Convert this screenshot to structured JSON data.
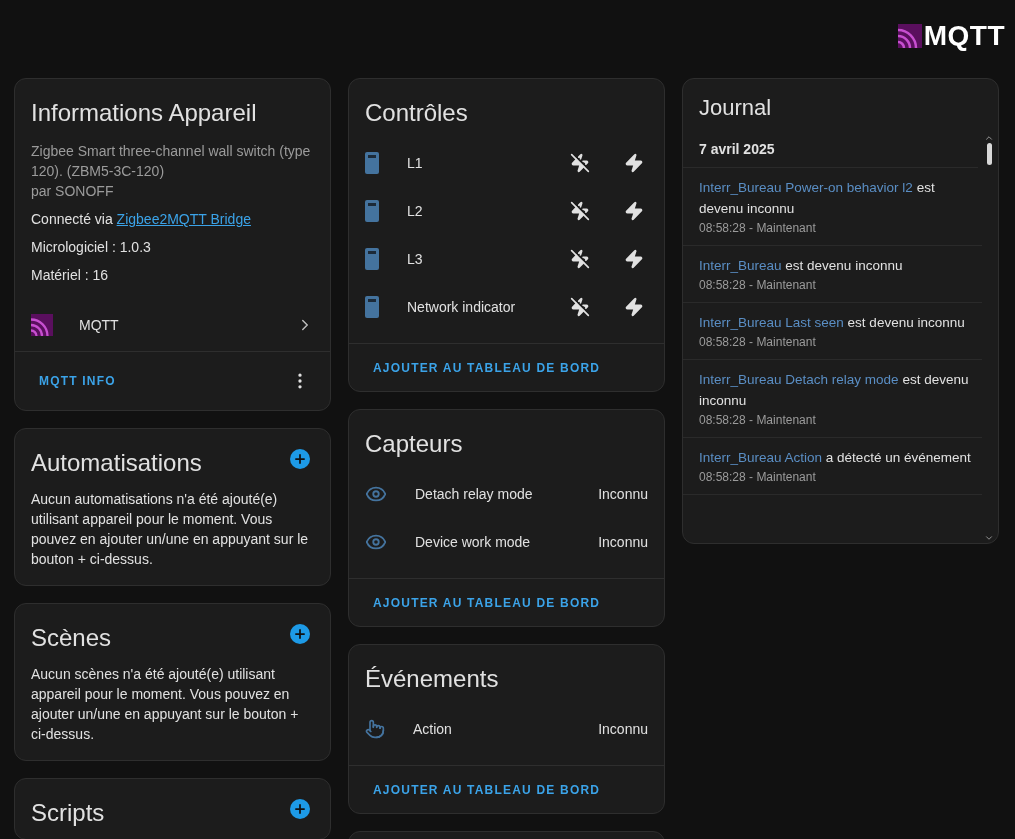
{
  "header": {
    "logo": "MQTT"
  },
  "device": {
    "title": "Informations Appareil",
    "description": "Zigbee Smart three-channel wall switch (type 120). (ZBM5-3C-120)",
    "manufacturer": "par SONOFF",
    "connected_label": "Connecté via",
    "connected_link": "Zigbee2MQTT Bridge",
    "firmware": "Micrologiciel : 1.0.3",
    "hardware": "Matériel : 16",
    "integration": "MQTT",
    "action": "MQTT INFO"
  },
  "sections": [
    {
      "title": "Automatisations",
      "text": "Aucun automatisations n'a été ajouté(e) utilisant appareil pour le moment. Vous pouvez en ajouter un/une en appuyant sur le bouton + ci-dessus."
    },
    {
      "title": "Scènes",
      "text": "Aucun scènes n'a été ajouté(e) utilisant appareil pour le moment. Vous pouvez en ajouter un/une en appuyant sur le bouton + ci-dessus."
    },
    {
      "title": "Scripts"
    }
  ],
  "entity_cards": [
    {
      "title": "Contrôles",
      "action": "AJOUTER AU TABLEAU DE BORD",
      "rows": [
        {
          "kind": "switch",
          "name": "L1"
        },
        {
          "kind": "switch",
          "name": "L2"
        },
        {
          "kind": "switch",
          "name": "L3"
        },
        {
          "kind": "switch",
          "name": "Network indicator"
        }
      ]
    },
    {
      "title": "Capteurs",
      "action": "AJOUTER AU TABLEAU DE BORD",
      "rows": [
        {
          "kind": "sensor",
          "name": "Detach relay mode",
          "value": "Inconnu"
        },
        {
          "kind": "sensor",
          "name": "Device work mode",
          "value": "Inconnu"
        }
      ]
    },
    {
      "title": "Événements",
      "action": "AJOUTER AU TABLEAU DE BORD",
      "rows": [
        {
          "kind": "event",
          "name": "Action",
          "value": "Inconnu"
        }
      ]
    }
  ],
  "journal": {
    "title": "Journal",
    "date": "7 avril 2025",
    "entries": [
      {
        "entity": "Interr_Bureau Power-on behavior l2",
        "message": "est devenu inconnu",
        "time": "08:58:28 - Maintenant"
      },
      {
        "entity": "Interr_Bureau",
        "message": "est devenu inconnu",
        "time": "08:58:28 - Maintenant"
      },
      {
        "entity": "Interr_Bureau Last seen",
        "message": "est devenu inconnu",
        "time": "08:58:28 - Maintenant"
      },
      {
        "entity": "Interr_Bureau Detach relay mode",
        "message": "est devenu inconnu",
        "time": "08:58:28 - Maintenant"
      },
      {
        "entity": "Interr_Bureau Action",
        "message": "a détecté un événement",
        "time": "08:58:28 - Maintenant"
      }
    ]
  }
}
